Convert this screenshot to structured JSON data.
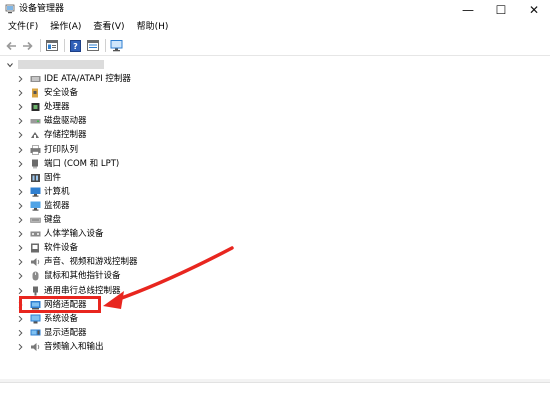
{
  "window": {
    "title": "设备管理器",
    "minimize_glyph": "—",
    "maximize_glyph": "☐",
    "close_glyph": "✕"
  },
  "menu": [
    "文件(F)",
    "操作(A)",
    "查看(V)",
    "帮助(H)"
  ],
  "toolbar": {
    "buttons": [
      "back-arrow-icon",
      "forward-arrow-icon",
      "properties-icon",
      "help-icon",
      "update-driver-icon",
      "scan-hardware-icon"
    ]
  },
  "tree": {
    "root_label_obscured": true,
    "items": [
      {
        "label": "IDE ATA/ATAPI 控制器",
        "icon": "ide-controller-icon"
      },
      {
        "label": "安全设备",
        "icon": "security-device-icon"
      },
      {
        "label": "处理器",
        "icon": "processor-icon"
      },
      {
        "label": "磁盘驱动器",
        "icon": "disk-drive-icon"
      },
      {
        "label": "存储控制器",
        "icon": "storage-controller-icon"
      },
      {
        "label": "打印队列",
        "icon": "print-queue-icon"
      },
      {
        "label": "端口 (COM 和 LPT)",
        "icon": "port-icon"
      },
      {
        "label": "固件",
        "icon": "firmware-icon"
      },
      {
        "label": "计算机",
        "icon": "computer-icon"
      },
      {
        "label": "监视器",
        "icon": "monitor-icon"
      },
      {
        "label": "键盘",
        "icon": "keyboard-icon"
      },
      {
        "label": "人体学输入设备",
        "icon": "hid-icon"
      },
      {
        "label": "软件设备",
        "icon": "software-device-icon"
      },
      {
        "label": "声音、视频和游戏控制器",
        "icon": "audio-icon"
      },
      {
        "label": "鼠标和其他指针设备",
        "icon": "mouse-icon"
      },
      {
        "label": "通用串行总线控制器",
        "icon": "usb-icon"
      },
      {
        "label": "网络适配器",
        "icon": "network-adapter-icon",
        "highlighted": true
      },
      {
        "label": "系统设备",
        "icon": "system-device-icon"
      },
      {
        "label": "显示适配器",
        "icon": "display-adapter-icon"
      },
      {
        "label": "音频输入和输出",
        "icon": "audio-io-icon"
      }
    ]
  },
  "colors": {
    "annotation_red": "#e8261f",
    "icon_blue": "#2f7fd0",
    "icon_gray": "#6b6b6b"
  }
}
